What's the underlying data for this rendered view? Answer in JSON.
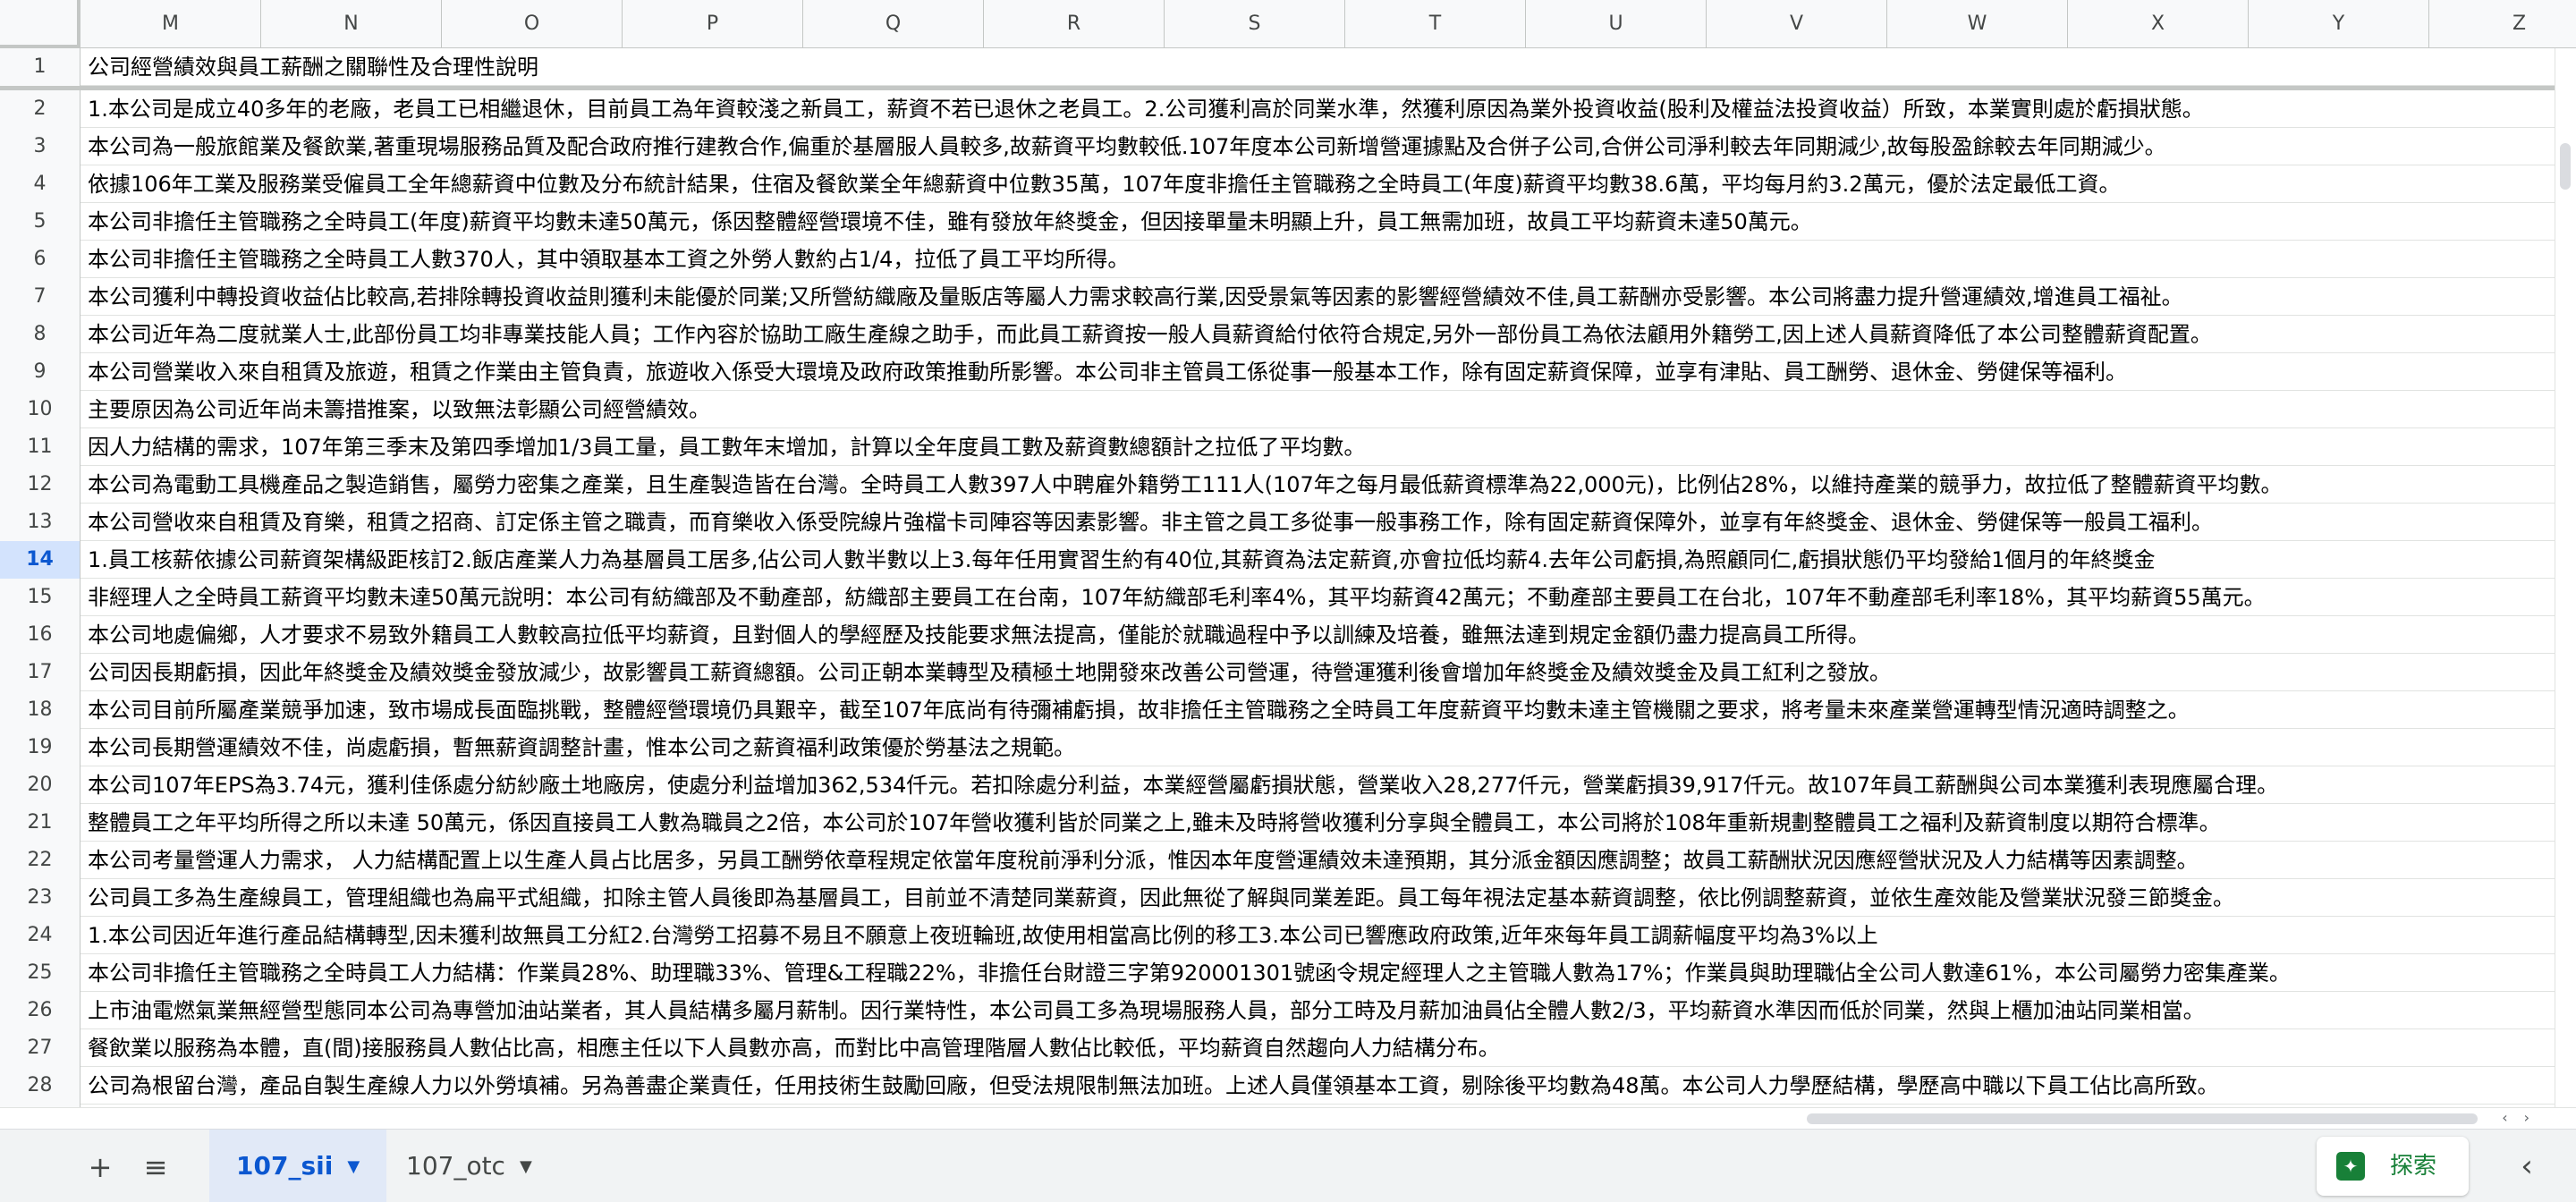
{
  "columns": [
    "M",
    "N",
    "O",
    "P",
    "Q",
    "R",
    "S",
    "T",
    "U",
    "V",
    "W",
    "X",
    "Y",
    "Z"
  ],
  "selected_row": "14",
  "rows": [
    {
      "num": "1",
      "text": "公司經營績效與員工薪酬之關聯性及合理性說明"
    },
    {
      "num": "2",
      "text": "1.本公司是成立40多年的老廠，老員工已相繼退休，目前員工為年資較淺之新員工，薪資不若已退休之老員工。2.公司獲利高於同業水準，然獲利原因為業外投資收益(股利及權益法投資收益）所致，本業實則處於虧損狀態。"
    },
    {
      "num": "3",
      "text": "本公司為一般旅館業及餐飲業,著重現場服務品質及配合政府推行建教合作,偏重於基層服人員較多,故薪資平均數較低.107年度本公司新增營運據點及合併子公司,合併公司淨利較去年同期減少,故每股盈餘較去年同期減少。"
    },
    {
      "num": "4",
      "text": "依據106年工業及服務業受僱員工全年總薪資中位數及分布統計結果，住宿及餐飲業全年總薪資中位數35萬，107年度非擔任主管職務之全時員工(年度)薪資平均數38.6萬，平均每月約3.2萬元，優於法定最低工資。"
    },
    {
      "num": "5",
      "text": "本公司非擔任主管職務之全時員工(年度)薪資平均數未達50萬元，係因整體經營環境不佳，雖有發放年終獎金，但因接單量未明顯上升，員工無需加班，故員工平均薪資未達50萬元。"
    },
    {
      "num": "6",
      "text": "本公司非擔任主管職務之全時員工人數370人，其中領取基本工資之外勞人數約占1/4，拉低了員工平均所得。"
    },
    {
      "num": "7",
      "text": "本公司獲利中轉投資收益佔比較高,若排除轉投資收益則獲利未能優於同業;又所營紡織廠及量販店等屬人力需求較高行業,因受景氣等因素的影響經營績效不佳,員工薪酬亦受影響。本公司將盡力提升營運績效,增進員工福祉。"
    },
    {
      "num": "8",
      "text": "本公司近年為二度就業人士,此部份員工均非專業技能人員；工作內容於協助工廠生產線之助手，而此員工薪資按一般人員薪資給付依符合規定,另外一部份員工為依法顧用外籍勞工,因上述人員薪資降低了本公司整體薪資配置。"
    },
    {
      "num": "9",
      "text": "本公司營業收入來自租賃及旅遊，租賃之作業由主管負責，旅遊收入係受大環境及政府政策推動所影響。本公司非主管員工係從事一般基本工作，除有固定薪資保障，並享有津貼、員工酬勞、退休金、勞健保等福利。"
    },
    {
      "num": "10",
      "text": "主要原因為公司近年尚未籌措推案，以致無法彰顯公司經營績效。"
    },
    {
      "num": "11",
      "text": "因人力結構的需求，107年第三季末及第四季增加1/3員工量，員工數年末增加，計算以全年度員工數及薪資數總額計之拉低了平均數。"
    },
    {
      "num": "12",
      "text": "本公司為電動工具機產品之製造銷售，屬勞力密集之產業，且生產製造皆在台灣。全時員工人數397人中聘雇外籍勞工111人(107年之每月最低薪資標準為22,000元)，比例佔28%，以維持產業的競爭力，故拉低了整體薪資平均數。"
    },
    {
      "num": "13",
      "text": "本公司營收來自租賃及育樂，租賃之招商、訂定係主管之職責，而育樂收入係受院線片強檔卡司陣容等因素影響。非主管之員工多從事一般事務工作，除有固定薪資保障外，並享有年終獎金、退休金、勞健保等一般員工福利。"
    },
    {
      "num": "14",
      "text": "1.員工核薪依據公司薪資架構級距核訂2.飯店產業人力為基層員工居多,佔公司人數半數以上3.每年任用實習生約有40位,其薪資為法定薪資,亦會拉低均薪4.去年公司虧損,為照顧同仁,虧損狀態仍平均發給1個月的年終獎金"
    },
    {
      "num": "15",
      "text": "非經理人之全時員工薪資平均數未達50萬元說明：本公司有紡織部及不動產部，紡織部主要員工在台南，107年紡織部毛利率4%，其平均薪資42萬元；不動產部主要員工在台北，107年不動產部毛利率18%，其平均薪資55萬元。"
    },
    {
      "num": "16",
      "text": "本公司地處偏鄉，人才要求不易致外籍員工人數較高拉低平均薪資，且對個人的學經歷及技能要求無法提高，僅能於就職過程中予以訓練及培養，雖無法達到規定金額仍盡力提高員工所得。"
    },
    {
      "num": "17",
      "text": "公司因長期虧損，因此年終獎金及績效獎金發放減少，故影響員工薪資總額。公司正朝本業轉型及積極土地開發來改善公司營運，待營運獲利後會增加年終獎金及績效獎金及員工紅利之發放。"
    },
    {
      "num": "18",
      "text": "本公司目前所屬產業競爭加速，致市場成長面臨挑戰，整體經營環境仍具艱辛，截至107年底尚有待彌補虧損，故非擔任主管職務之全時員工年度薪資平均數未達主管機關之要求，將考量未來產業營運轉型情況適時調整之。"
    },
    {
      "num": "19",
      "text": "本公司長期營運績效不佳，尚處虧損，暫無薪資調整計畫，惟本公司之薪資福利政策優於勞基法之規範。"
    },
    {
      "num": "20",
      "text": "本公司107年EPS為3.74元，獲利佳係處分紡紗廠土地廠房，使處分利益增加362,534仟元。若扣除處分利益，本業經營屬虧損狀態，營業收入28,277仟元，營業虧損39,917仟元。故107年員工薪酬與公司本業獲利表現應屬合理。"
    },
    {
      "num": "21",
      "text": "整體員工之年平均所得之所以未達 50萬元，係因直接員工人數為職員之2倍，本公司於107年營收獲利皆於同業之上,雖未及時將營收獲利分享與全體員工，本公司將於108年重新規劃整體員工之福利及薪資制度以期符合標準。"
    },
    {
      "num": "22",
      "text": "本公司考量營運人力需求， 人力結構配置上以生產人員占比居多，另員工酬勞依章程規定依當年度稅前淨利分派，惟因本年度營運績效未達預期，其分派金額因應調整；故員工薪酬狀況因應經營狀況及人力結構等因素調整。"
    },
    {
      "num": "23",
      "text": "公司員工多為生產線員工，管理組織也為扁平式組織，扣除主管人員後即為基層員工，目前並不清楚同業薪資，因此無從了解與同業差距。員工每年視法定基本薪資調整，依比例調整薪資，並依生產效能及營業狀況發三節獎金。"
    },
    {
      "num": "24",
      "text": "1.本公司因近年進行產品結構轉型,因未獲利故無員工分紅2.台灣勞工招募不易且不願意上夜班輪班,故使用相當高比例的移工3.本公司已響應政府政策,近年來每年員工調薪幅度平均為3%以上"
    },
    {
      "num": "25",
      "text": "本公司非擔任主管職務之全時員工人力結構：作業員28%、助理職33%、管理&工程職22%，非擔任台財證三字第920001301號函令規定經理人之主管職人數為17%；作業員與助理職佔全公司人數達61%，本公司屬勞力密集產業。"
    },
    {
      "num": "26",
      "text": "上市油電燃氣業無經營型態同本公司為專營加油站業者，其人員結構多屬月薪制。因行業特性，本公司員工多為現場服務人員，部分工時及月薪加油員佔全體人數2/3，平均薪資水準因而低於同業，然與上櫃加油站同業相當。"
    },
    {
      "num": "27",
      "text": "餐飲業以服務為本體，直(間)接服務員人數佔比高，相應主任以下人員數亦高，而對比中高管理階層人數佔比較低，平均薪資自然趨向人力結構分布。"
    },
    {
      "num": "28",
      "text": "公司為根留台灣，產品自製生產線人力以外勞填補。另為善盡企業責任，任用技術生鼓勵回廠，但受法規限制無法加班。上述人員僅領基本工資，剔除後平均數為48萬。本公司人力學歷結構，學歷高中職以下員工佔比高所致。"
    }
  ],
  "tabbar": {
    "add_icon": "plus-icon",
    "menu_icon": "list-icon",
    "tabs": [
      {
        "label": "107_sii",
        "active": true
      },
      {
        "label": "107_otc",
        "active": false
      }
    ],
    "explore_label": "探索"
  },
  "colors": {
    "accent": "#0b57d0",
    "explore": "#188038",
    "header_bg": "#f8f9fa",
    "grid": "#e1e3e1"
  }
}
